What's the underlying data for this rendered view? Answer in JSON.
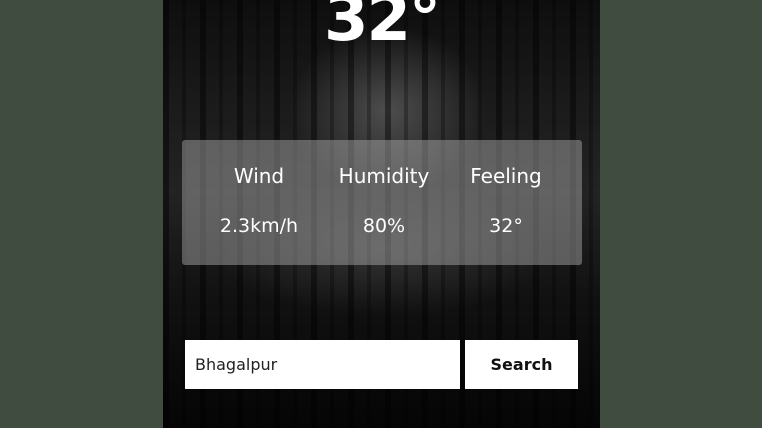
{
  "weather": {
    "temperature": "32°"
  },
  "stats": [
    {
      "label": "Wind",
      "value": "2.3km/h"
    },
    {
      "label": "Humidity",
      "value": "80%"
    },
    {
      "label": "Feeling",
      "value": "32°"
    }
  ],
  "search": {
    "value": "Bhagalpur",
    "button_label": "Search"
  },
  "colors": {
    "page_background": "#414c40",
    "panel_background": "#aaaaaa",
    "text": "#ffffff"
  }
}
